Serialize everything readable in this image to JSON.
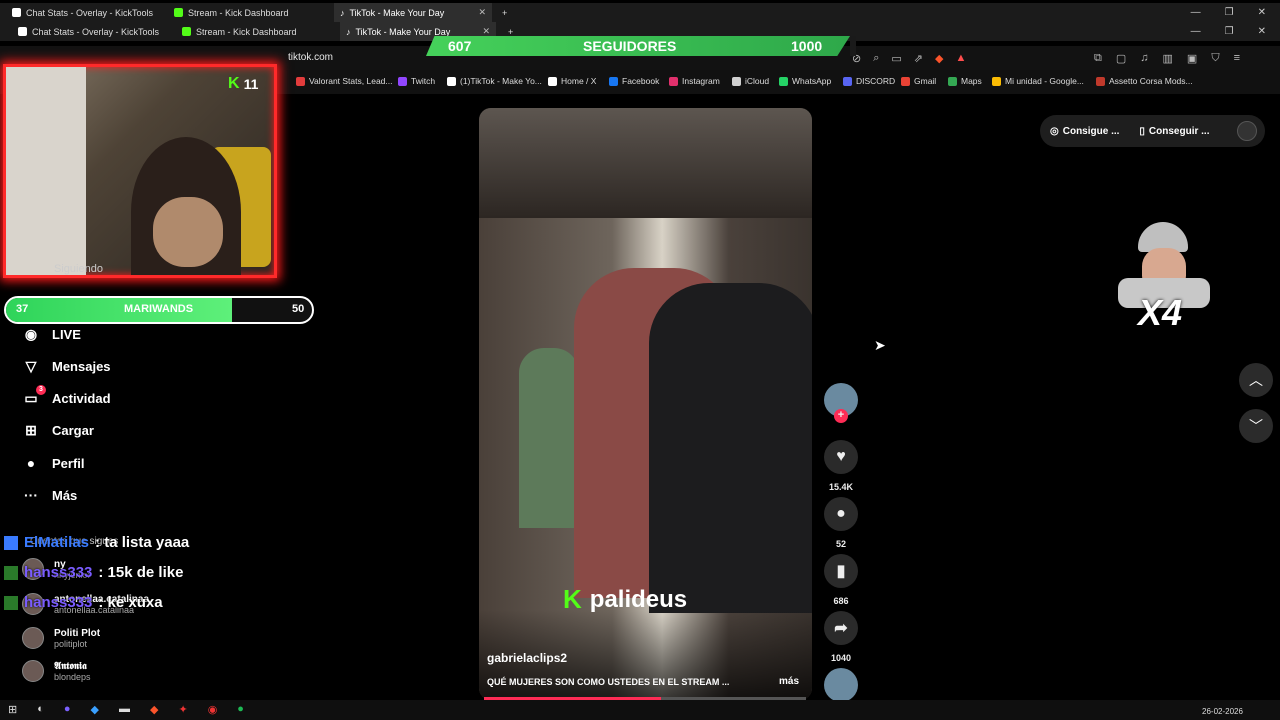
{
  "tabs_row1": [
    {
      "label": "Chat Stats - Overlay - KickTools",
      "color": "#ffffff"
    },
    {
      "label": "Stream - Kick Dashboard",
      "color": "#53fc18"
    },
    {
      "label": "TikTok - Make Your Day",
      "color": "#ffffff"
    }
  ],
  "tabs_row2": [
    {
      "label": "Chat Stats - Overlay - KickTools"
    },
    {
      "label": "Stream - Kick Dashboard"
    },
    {
      "label": "TikTok - Make Your Day"
    }
  ],
  "address": {
    "url": "tiktok.com"
  },
  "followers": {
    "current": "607",
    "label": "SEGUIDORES",
    "goal": "1000",
    "progress": 0.607
  },
  "kick_badge": {
    "count": "11"
  },
  "bookmarks": [
    {
      "label": "Valorant Stats, Lead...",
      "color": "#e23c3c"
    },
    {
      "label": "Twitch",
      "color": "#9146ff"
    },
    {
      "label": "(1)TikTok - Make Yo...",
      "color": "#ffffff"
    },
    {
      "label": "Home / X",
      "color": "#ffffff"
    },
    {
      "label": "Facebook",
      "color": "#1877f2"
    },
    {
      "label": "Instagram",
      "color": "#e1306c"
    },
    {
      "label": "iCloud",
      "color": "#d0d0d0"
    },
    {
      "label": "WhatsApp",
      "color": "#25d366"
    },
    {
      "label": "DISCORD",
      "color": "#5865f2"
    },
    {
      "label": "Gmail",
      "color": "#ea4335"
    },
    {
      "label": "Maps",
      "color": "#34a853"
    },
    {
      "label": "Mi unidad - Google...",
      "color": "#fbbc04"
    },
    {
      "label": "Assetto Corsa Mods...",
      "color": "#c0392b"
    }
  ],
  "goal_pill": {
    "current": "37",
    "label": "MARIWANDS",
    "goal": "50",
    "progress": 0.74
  },
  "webcam_caption": "Siguiendo",
  "sidebar": [
    {
      "label": "LIVE",
      "icon": "live-avatar-icon"
    },
    {
      "label": "Mensajes",
      "icon": "send-icon"
    },
    {
      "label": "Actividad",
      "icon": "inbox-icon",
      "badge": "3"
    },
    {
      "label": "Cargar",
      "icon": "plus-box-icon"
    },
    {
      "label": "Perfil",
      "icon": "profile-icon"
    },
    {
      "label": "Más",
      "icon": "more-icon"
    }
  ],
  "following_heading": "Cuentas que sigues",
  "accounts": [
    {
      "name": "ny",
      "handle": "nnyjenxx"
    },
    {
      "name": "antonellaa.catalinaa",
      "handle": "antonellaa.catalinaa"
    },
    {
      "name": "Politi Plot",
      "handle": "politiplot"
    },
    {
      "name": "𝕬𝖓𝖙𝖔𝖓𝖎𝖆",
      "handle": "blondeps"
    }
  ],
  "chat": [
    {
      "user": "ElMatilas",
      "message": ": ta lista yaaa",
      "user_color": "#3a7bff"
    },
    {
      "user": "hanss333",
      "message": ": 15k de like",
      "user_color": "#7a5cff"
    },
    {
      "user": "hanss333",
      "message": ": ke xuxa",
      "user_color": "#7a5cff"
    }
  ],
  "video": {
    "username": "gabrielaclips2",
    "caption": "QUÉ MUJERES SON COMO USTEDES EN EL STREAM ...",
    "more": "más",
    "watermark": "palideus",
    "progress": 0.55
  },
  "actions": {
    "likes": "15.4K",
    "comments": "52",
    "saves": "686",
    "shares": "1040"
  },
  "right_panel": {
    "btn1": "Consigue ...",
    "btn2": "Conseguir ..."
  },
  "emote": {
    "label": "X4"
  },
  "taskbar": {
    "date": "26-02-2026"
  }
}
